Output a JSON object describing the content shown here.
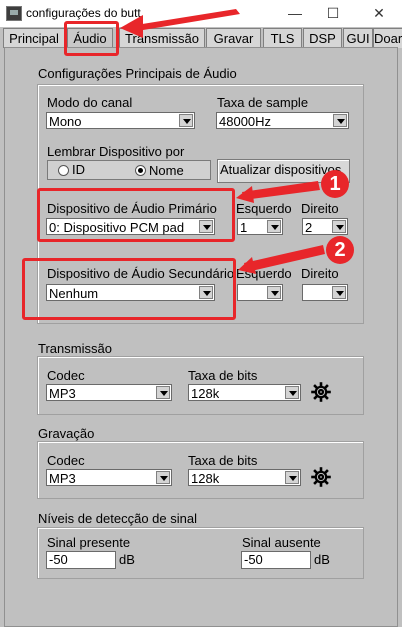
{
  "window": {
    "title": "configurações do butt"
  },
  "tabs": [
    "Principal",
    "Áudio",
    "Transmissão",
    "Gravar",
    "TLS",
    "DSP",
    "GUI",
    "Doar"
  ],
  "main_settings": {
    "title": "Configurações Principais de Áudio",
    "channel_mode_label": "Modo do canal",
    "channel_mode_value": "Mono",
    "sample_rate_label": "Taxa de sample",
    "sample_rate_value": "48000Hz",
    "remember_device_label": "Lembrar Dispositivo por",
    "radio_id": "ID",
    "radio_name": "Nome",
    "update_devices_button": "Atualizar dispositivos",
    "primary_device_label": "Dispositivo de Áudio Primário",
    "primary_device_value": "0: Dispositivo PCM pad",
    "left_label_1": "Esquerdo",
    "right_label_1": "Direito",
    "left_value_1": "1",
    "right_value_1": "2",
    "secondary_device_label": "Dispositivo de Áudio Secundário",
    "secondary_device_value": "Nenhum",
    "left_label_2": "Esquerdo",
    "right_label_2": "Direito"
  },
  "annotations": {
    "badge1": "1",
    "badge2": "2"
  },
  "transmission": {
    "title": "Transmissão",
    "codec_label": "Codec",
    "codec_value": "MP3",
    "bitrate_label": "Taxa de bits",
    "bitrate_value": "128k"
  },
  "recording": {
    "title": "Gravação",
    "codec_label": "Codec",
    "codec_value": "MP3",
    "bitrate_label": "Taxa de bits",
    "bitrate_value": "128k"
  },
  "signal": {
    "title": "Níveis de detecção de sinal",
    "present_label": "Sinal presente",
    "present_value": "-50",
    "present_unit": "dB",
    "absent_label": "Sinal ausente",
    "absent_value": "-50",
    "absent_unit": "dB"
  }
}
